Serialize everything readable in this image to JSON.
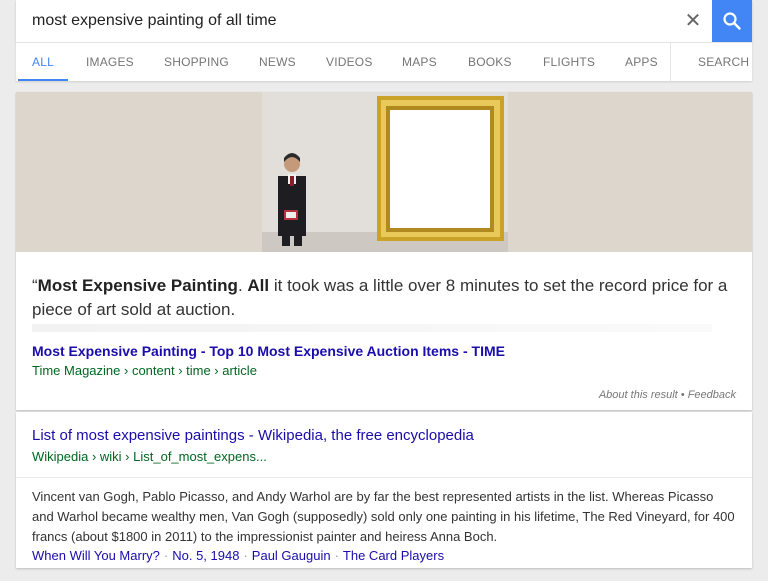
{
  "search": {
    "query": "most expensive painting of all time",
    "clear_icon": "close-icon",
    "search_icon": "search-icon"
  },
  "tabs": [
    {
      "label": "ALL",
      "active": true
    },
    {
      "label": "IMAGES"
    },
    {
      "label": "SHOPPING"
    },
    {
      "label": "NEWS"
    },
    {
      "label": "VIDEOS"
    },
    {
      "label": "MAPS"
    },
    {
      "label": "BOOKS"
    },
    {
      "label": "FLIGHTS"
    },
    {
      "label": "APPS"
    },
    {
      "label": "SEARCH"
    }
  ],
  "featured": {
    "quote_mark": "“",
    "bold_1": "Most Expensive Painting",
    "text_1": ". ",
    "bold_2": "All",
    "text_2": " it took was a little over 8 minutes to set the record price for a piece of art sold at auction.",
    "title": "Most Expensive Painting - Top 10 Most Expensive Auction Items - TIME",
    "breadcrumb": "Time Magazine › content › time › article",
    "about": "About this result",
    "bullet": " • ",
    "feedback": "Feedback"
  },
  "wiki": {
    "title": "List of most expensive paintings - Wikipedia, the free encyclopedia",
    "breadcrumb": "Wikipedia › wiki › List_of_most_expens...",
    "snippet": "Vincent van Gogh, Pablo Picasso, and Andy Warhol are by far the best represented artists in the list. Whereas Picasso and Warhol became wealthy men, Van Gogh (supposedly) sold only one painting in his lifetime, The Red Vineyard, for 400 francs (about $1800 in 2011) to the impressionist painter and heiress Anna Boch.",
    "sitelinks": [
      "When Will You Marry?",
      "No. 5, 1948",
      "Paul Gauguin",
      "The Card Players"
    ],
    "sitelink_separator": "·"
  },
  "colors": {
    "accent": "#4285f4",
    "link": "#1a0dab",
    "url_green": "#006621"
  }
}
